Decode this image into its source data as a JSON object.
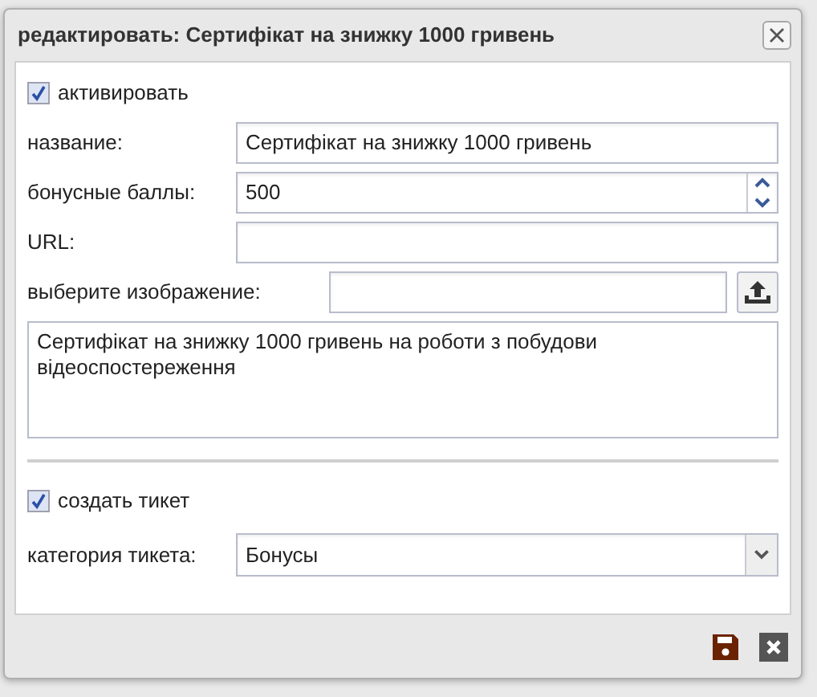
{
  "dialog": {
    "title": "редактировать: Сертифікат на знижку 1000 гривень"
  },
  "activate": {
    "label": "активировать",
    "checked": true
  },
  "fields": [
    {
      "kind": "text",
      "label": "название:",
      "value": "Сертифікат на знижку 1000 гривень"
    },
    {
      "kind": "number",
      "label": "бонусные баллы:",
      "value": "500"
    },
    {
      "kind": "text",
      "label": "URL:"
    },
    {
      "kind": "file",
      "label": "выберите изображение:"
    }
  ],
  "description": "Сертифікат на знижку 1000 гривень на роботи з побудови відеоспостереження",
  "create_ticket": {
    "label": "создать тикет",
    "checked": true
  },
  "ticket_category": {
    "label": "категория тикета:",
    "value": "Бонусы"
  }
}
